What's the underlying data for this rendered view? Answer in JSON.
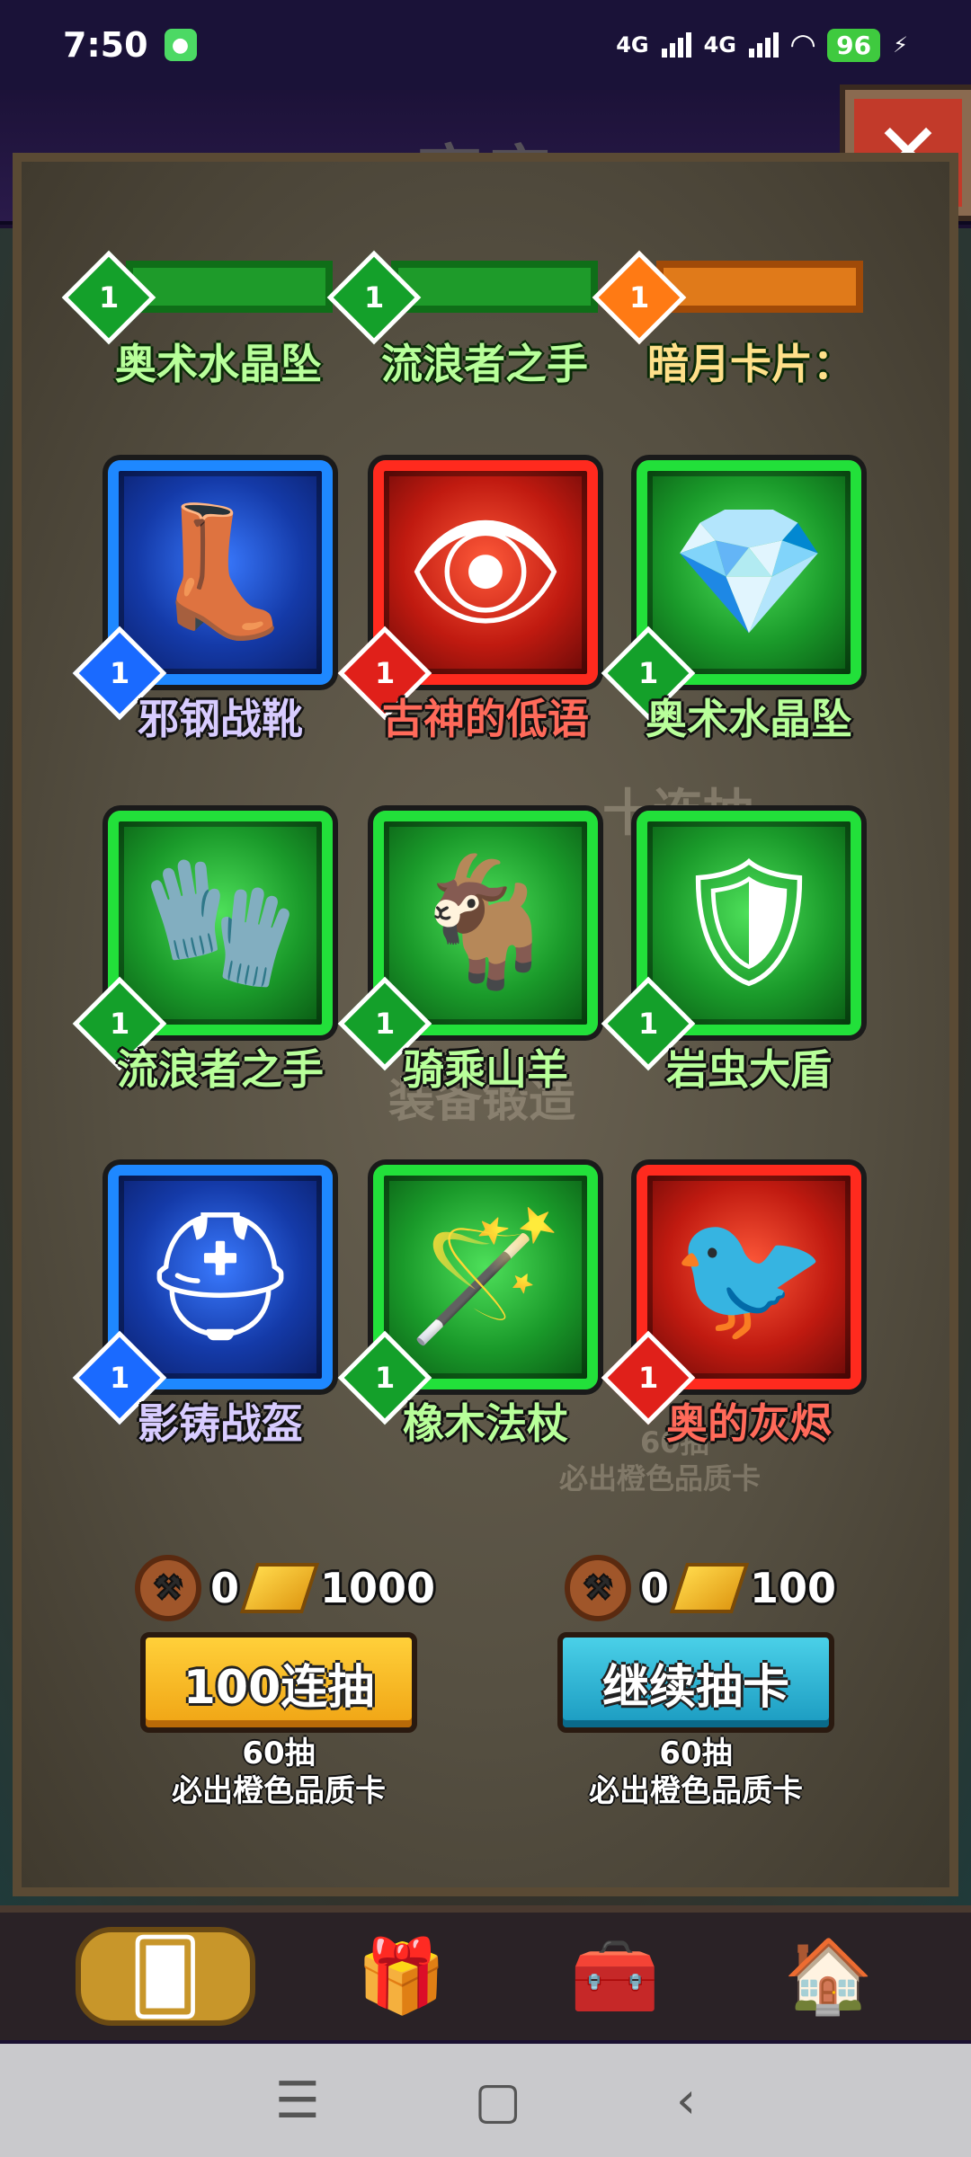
{
  "status_bar": {
    "time": "7:50",
    "network1": "4G",
    "network2": "4G",
    "battery": "96"
  },
  "header": {
    "title": "商店"
  },
  "top_row": [
    {
      "name": "奥术水晶坠",
      "level": "1",
      "rarity": "green"
    },
    {
      "name": "流浪者之手",
      "level": "1",
      "rarity": "green"
    },
    {
      "name": "暗月卡片：",
      "level": "1",
      "rarity": "orange"
    }
  ],
  "cards": [
    {
      "name": "邪钢战靴",
      "level": "1",
      "rarity": "blue",
      "icon": "boots-icon",
      "glyph": "👢"
    },
    {
      "name": "古神的低语",
      "level": "1",
      "rarity": "red",
      "icon": "eye-amulet-icon",
      "glyph": "👁"
    },
    {
      "name": "奥术水晶坠",
      "level": "1",
      "rarity": "green",
      "icon": "crystal-pendant-icon",
      "glyph": "💎"
    },
    {
      "name": "流浪者之手",
      "level": "1",
      "rarity": "green",
      "icon": "gauntlet-icon",
      "glyph": "🧤"
    },
    {
      "name": "骑乘山羊",
      "level": "1",
      "rarity": "green",
      "icon": "mountain-goat-icon",
      "glyph": "🐐"
    },
    {
      "name": "岩虫大盾",
      "level": "1",
      "rarity": "green",
      "icon": "shield-icon",
      "glyph": "🛡"
    },
    {
      "name": "影铸战盔",
      "level": "1",
      "rarity": "blue",
      "icon": "helmet-icon",
      "glyph": "⛑"
    },
    {
      "name": "橡木法杖",
      "level": "1",
      "rarity": "green",
      "icon": "staff-icon",
      "glyph": "🪄"
    },
    {
      "name": "奥的灰烬",
      "level": "1",
      "rarity": "red",
      "icon": "phoenix-icon",
      "glyph": "🐦"
    }
  ],
  "background_text": {
    "ten_pull": "十连抽",
    "forge": "装备锻造",
    "pity_count": "60抽",
    "pity_text": "必出橙色品质卡"
  },
  "left_offer": {
    "anvil_count": "0",
    "gold_cost": "1000",
    "button_label": "100连抽",
    "pity_line1": "60抽",
    "pity_line2": "必出橙色品质卡"
  },
  "right_offer": {
    "anvil_count": "0",
    "gold_cost": "100",
    "button_label": "继续抽卡",
    "pity_line1": "60抽",
    "pity_line2": "必出橙色品质卡"
  },
  "bottom_nav": [
    {
      "icon": "card-pack-icon",
      "active": true
    },
    {
      "icon": "gift-icon",
      "active": false
    },
    {
      "icon": "treasure-chest-icon",
      "active": false
    },
    {
      "icon": "tavern-icon",
      "active": false
    }
  ],
  "colors": {
    "blue_rarity": "#1e88ff",
    "green_rarity": "#22e03a",
    "red_rarity": "#ff2a1e",
    "orange_rarity": "#ff7a14",
    "yellow_button": "#f0a414",
    "cyan_button": "#1a9ac0"
  }
}
